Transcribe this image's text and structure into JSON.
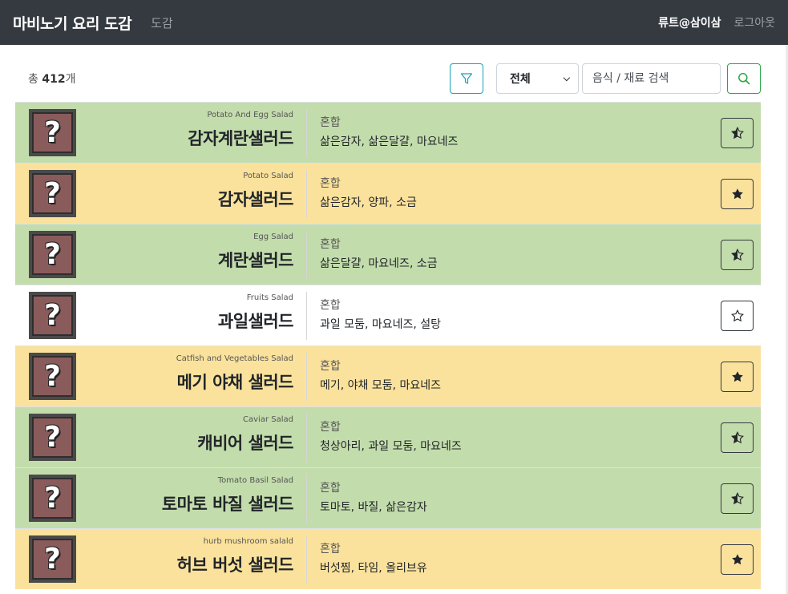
{
  "header": {
    "brand": "마비노기 요리 도감",
    "nav_link": "도감",
    "user": "류트@삼이삼",
    "logout": "로그아웃"
  },
  "toolbar": {
    "total_prefix": "총",
    "total_count": "412",
    "total_suffix": "개",
    "filter_icon": "filter-icon",
    "select_value": "전체",
    "search_placeholder": "음식 / 재료 검색",
    "search_icon": "search-icon"
  },
  "colors": {
    "green": "#c3dcac",
    "yellow": "#fbe29c",
    "white": "#ffffff"
  },
  "recipes": [
    {
      "en": "Potato And Egg Salad",
      "ko": "감자계란샐러드",
      "category": "혼합",
      "ingredients": "삶은감자, 삶은달걀, 마요네즈",
      "color": "green",
      "star": "half"
    },
    {
      "en": "Potato Salad",
      "ko": "감자샐러드",
      "category": "혼합",
      "ingredients": "삶은감자, 양파, 소금",
      "color": "yellow",
      "star": "full"
    },
    {
      "en": "Egg Salad",
      "ko": "계란샐러드",
      "category": "혼합",
      "ingredients": "삶은달걀, 마요네즈, 소금",
      "color": "green",
      "star": "half"
    },
    {
      "en": "Fruits Salad",
      "ko": "과일샐러드",
      "category": "혼합",
      "ingredients": "과일 모둠, 마요네즈, 설탕",
      "color": "white",
      "star": "empty"
    },
    {
      "en": "Catfish and Vegetables Salad",
      "ko": "메기 야채 샐러드",
      "category": "혼합",
      "ingredients": "메기, 야채 모둠, 마요네즈",
      "color": "yellow",
      "star": "full"
    },
    {
      "en": "Caviar Salad",
      "ko": "캐비어 샐러드",
      "category": "혼합",
      "ingredients": "청상아리, 과일 모둠, 마요네즈",
      "color": "green",
      "star": "half"
    },
    {
      "en": "Tomato Basil Salad",
      "ko": "토마토 바질 샐러드",
      "category": "혼합",
      "ingredients": "토마토, 바질, 삶은감자",
      "color": "green",
      "star": "half"
    },
    {
      "en": "hurb mushroom salald",
      "ko": "허브 버섯 샐러드",
      "category": "혼합",
      "ingredients": "버섯찜, 타임, 올리브유",
      "color": "yellow",
      "star": "full"
    }
  ]
}
